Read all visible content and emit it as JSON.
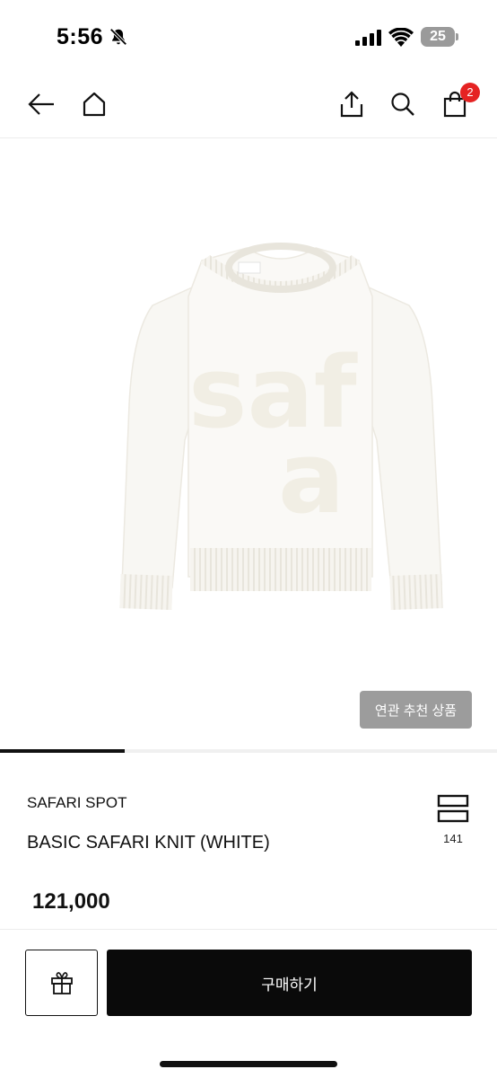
{
  "status_bar": {
    "time": "5:56",
    "battery": "25",
    "icons": [
      "bell-off-icon",
      "signal-icon",
      "wifi-icon",
      "battery-icon"
    ]
  },
  "nav": {
    "icons": [
      "back-arrow-icon",
      "home-icon",
      "share-icon",
      "search-icon",
      "shopping-bag-icon"
    ],
    "cart_count": "2"
  },
  "product_image": {
    "related_button_label": "연관 추천 상품",
    "carousel_progress": 0.25
  },
  "product": {
    "brand": "SAFARI SPOT",
    "name": "BASIC SAFARI KNIT (WHITE)",
    "price": "121,000",
    "like_count": "141"
  },
  "bottom_bar": {
    "gift_icon": "gift-icon",
    "buy_label": "구매하기"
  },
  "colors": {
    "badge": "#e52222",
    "buy_button": "#0a0a0a",
    "related_button": "#9c9c9c"
  }
}
